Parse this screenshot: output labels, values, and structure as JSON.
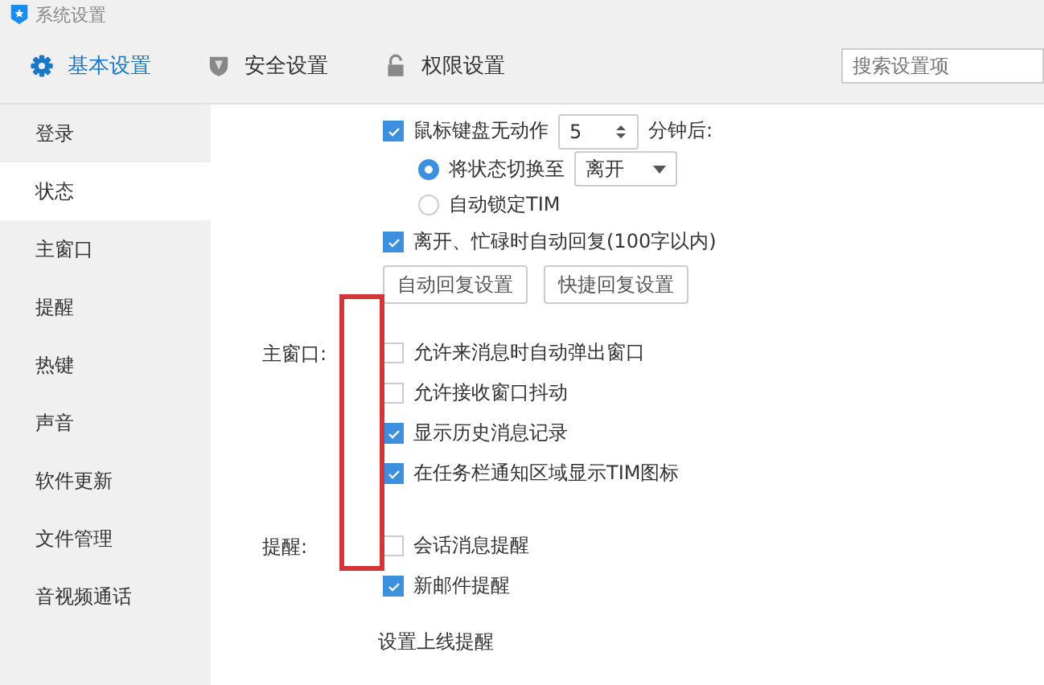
{
  "window": {
    "title": "系统设置"
  },
  "tabs": [
    {
      "label": "基本设置",
      "kind": "gear",
      "selected": true
    },
    {
      "label": "安全设置",
      "kind": "shield",
      "selected": false
    },
    {
      "label": "权限设置",
      "kind": "lock",
      "selected": false
    }
  ],
  "search": {
    "placeholder": "搜索设置项"
  },
  "sidebar": {
    "items": [
      {
        "label": "登录",
        "selected": false
      },
      {
        "label": "状态",
        "selected": true
      },
      {
        "label": "主窗口",
        "selected": false
      },
      {
        "label": "提醒",
        "selected": false
      },
      {
        "label": "热键",
        "selected": false
      },
      {
        "label": "声音",
        "selected": false
      },
      {
        "label": "软件更新",
        "selected": false
      },
      {
        "label": "文件管理",
        "selected": false
      },
      {
        "label": "音视频通话",
        "selected": false
      }
    ]
  },
  "status": {
    "idle": {
      "checked": true,
      "label": "鼠标键盘无动作",
      "minutes": "5",
      "suffix": "分钟后:"
    },
    "options": [
      {
        "label": "将状态切换至",
        "selected": true,
        "dropdown": "离开"
      },
      {
        "label": "自动锁定TIM",
        "selected": false
      }
    ],
    "auto_reply": {
      "checked": true,
      "label": "离开、忙碌时自动回复(100字以内)"
    },
    "buttons": [
      "自动回复设置",
      "快捷回复设置"
    ]
  },
  "main_window": {
    "label": "主窗口:",
    "options": [
      {
        "label": "允许来消息时自动弹出窗口",
        "checked": false
      },
      {
        "label": "允许接收窗口抖动",
        "checked": false
      },
      {
        "label": "显示历史消息记录",
        "checked": true
      },
      {
        "label": "在任务栏通知区域显示TIM图标",
        "checked": true
      }
    ]
  },
  "reminders": {
    "label": "提醒:",
    "options": [
      {
        "label": "会话消息提醒",
        "checked": false
      },
      {
        "label": "新邮件提醒",
        "checked": true
      }
    ],
    "link": "设置上线提醒"
  }
}
